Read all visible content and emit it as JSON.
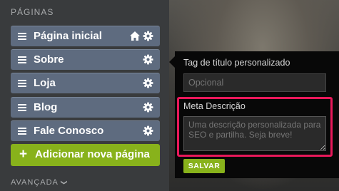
{
  "sidebar": {
    "section_title": "PÁGINAS",
    "pages": [
      {
        "label": "Página inicial",
        "home": true
      },
      {
        "label": "Sobre",
        "home": false
      },
      {
        "label": "Loja",
        "home": false
      },
      {
        "label": "Blog",
        "home": false
      },
      {
        "label": "Fale Conosco",
        "home": false
      }
    ],
    "add_page_label": "Adicionar nova página",
    "add_page_icon": "+",
    "advanced_label": "AVANÇADA",
    "advanced_icon": "chevron-down-icon"
  },
  "popup": {
    "title_tag_label": "Tag de título personalizado",
    "title_tag_placeholder": "Opcional",
    "meta_label": "Meta Descrição",
    "meta_placeholder": "Uma descrição personalizada para SEO e partilha. Seja breve!",
    "save_label": "SALVAR"
  },
  "colors": {
    "sidebar_bg": "#393b3d",
    "page_item_bg": "#5e6b7f",
    "accent_green": "#88b21b",
    "highlight": "#e8185a",
    "popup_bg": "#080808"
  }
}
